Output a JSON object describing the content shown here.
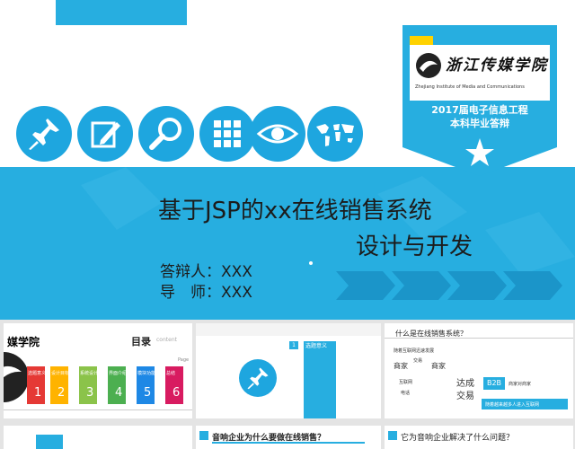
{
  "hero": {
    "badge_line1": "2017届电子信息工程",
    "badge_line2": "本科毕业答辩",
    "logo_text": "浙江传媒学院",
    "logo_subtext": "Zhejiang Institute of Media and Communications",
    "title_line1": "基于JSP的xx在线销售系统",
    "title_line2": "设计与开发",
    "defender_label": "答辩人：XXX",
    "advisor_label": "导　师：XXX"
  },
  "icons": [
    "pushpin-icon",
    "edit-icon",
    "magnifier-icon",
    "grid-icon",
    "eye-icon",
    "world-map-icon"
  ],
  "thumb1": {
    "title": "目录",
    "subtitle": "content",
    "page_label": "Page",
    "items": [
      {
        "label": "选题意义",
        "num": "1",
        "color": "#e53935"
      },
      {
        "label": "设计目标",
        "num": "2",
        "color": "#ffb300"
      },
      {
        "label": "系统设计",
        "num": "3",
        "color": "#8bc34a"
      },
      {
        "label": "界面介绍",
        "num": "4",
        "color": "#4caf50"
      },
      {
        "label": "模块功能",
        "num": "5",
        "color": "#1e88e5"
      },
      {
        "label": "总结",
        "num": "6",
        "color": "#d81b60"
      }
    ]
  },
  "thumb2": {
    "step": "1",
    "label": "选题意义"
  },
  "thumb3": {
    "title": "什么是在线销售系统？",
    "labels": [
      "随着互联网迅速发展",
      "商家",
      "交易",
      "商家",
      "互联网",
      "达成",
      "电话",
      "交易",
      "B2B",
      "商家对商家",
      "随着越来越多人进入互联网"
    ]
  },
  "thumb4": {
    "title": "音响企业为什么要做在线销售？"
  },
  "thumb5": {
    "title": "它为音响企业解决了什么问题？"
  },
  "colors": {
    "accent": "#27aee0",
    "dark": "#1c1c1c"
  }
}
